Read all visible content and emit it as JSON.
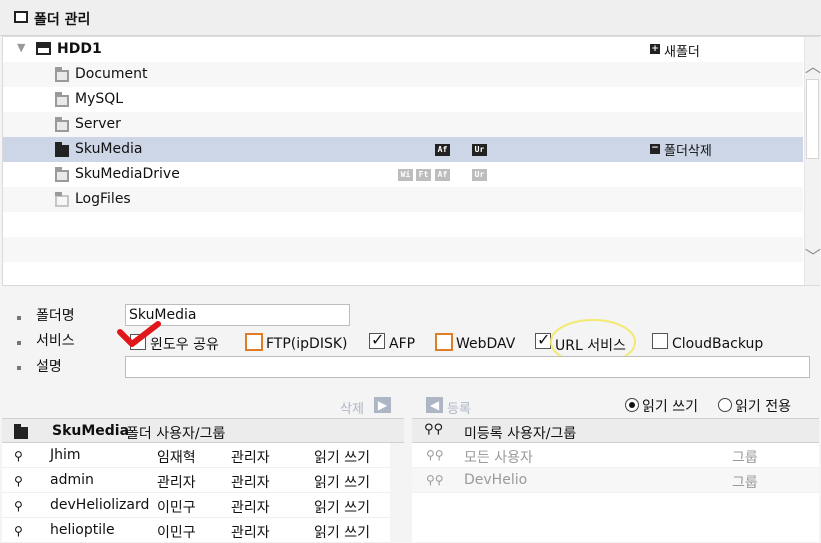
{
  "title": "폴더 관리",
  "tree": {
    "root": "HDD1",
    "new_folder": "새폴더",
    "delete_folder": "폴더삭제",
    "items": [
      {
        "name": "Document",
        "badges": []
      },
      {
        "name": "MySQL",
        "badges": []
      },
      {
        "name": "Server",
        "badges": []
      },
      {
        "name": "SkuMedia",
        "badges": [
          "Af",
          "Ur"
        ],
        "selected": true
      },
      {
        "name": "SkuMediaDrive",
        "badges": [
          "Wi",
          "Ft",
          "Af",
          "Ur"
        ]
      },
      {
        "name": "LogFiles",
        "badges": []
      }
    ]
  },
  "form": {
    "name_label": "폴더명",
    "name_value": "SkuMedia",
    "service_label": "서비스",
    "desc_label": "설명",
    "desc_value": "",
    "services": [
      {
        "label": "윈도우 공유",
        "checked": true
      },
      {
        "label": "FTP(ipDISK)",
        "checked": false
      },
      {
        "label": "AFP",
        "checked": true
      },
      {
        "label": "WebDAV",
        "checked": false
      },
      {
        "label": "URL 서비스",
        "checked": true
      },
      {
        "label": "CloudBackup",
        "checked": false
      }
    ]
  },
  "actions": {
    "delete": "삭제",
    "register": "등록",
    "rw": "읽기 쓰기",
    "ro": "읽기 전용",
    "selected_mode": "읽기 쓰기"
  },
  "left_panel": {
    "folder": "SkuMedia",
    "title_suffix": "폴더 사용자/그룹",
    "rows": [
      {
        "name": "Jhim",
        "real": "임재혁",
        "role": "관리자",
        "perm": "읽기 쓰기"
      },
      {
        "name": "admin",
        "real": "관리자",
        "role": "관리자",
        "perm": "읽기 쓰기"
      },
      {
        "name": "devHeliolizard",
        "real": "이민구",
        "role": "관리자",
        "perm": "읽기 쓰기"
      },
      {
        "name": "helioptile",
        "real": "이민구",
        "role": "관리자",
        "perm": "읽기 쓰기"
      }
    ]
  },
  "right_panel": {
    "title": "미등록 사용자/그룹",
    "rows": [
      {
        "name": "모든 사용자",
        "type": "그룹"
      },
      {
        "name": "DevHelio",
        "type": "그룹"
      }
    ]
  },
  "colors": {
    "selection": "#cdd6e6",
    "accent": "#e07b26",
    "annotation_red": "#e0161b",
    "annotation_yellow": "#f3ea71"
  }
}
